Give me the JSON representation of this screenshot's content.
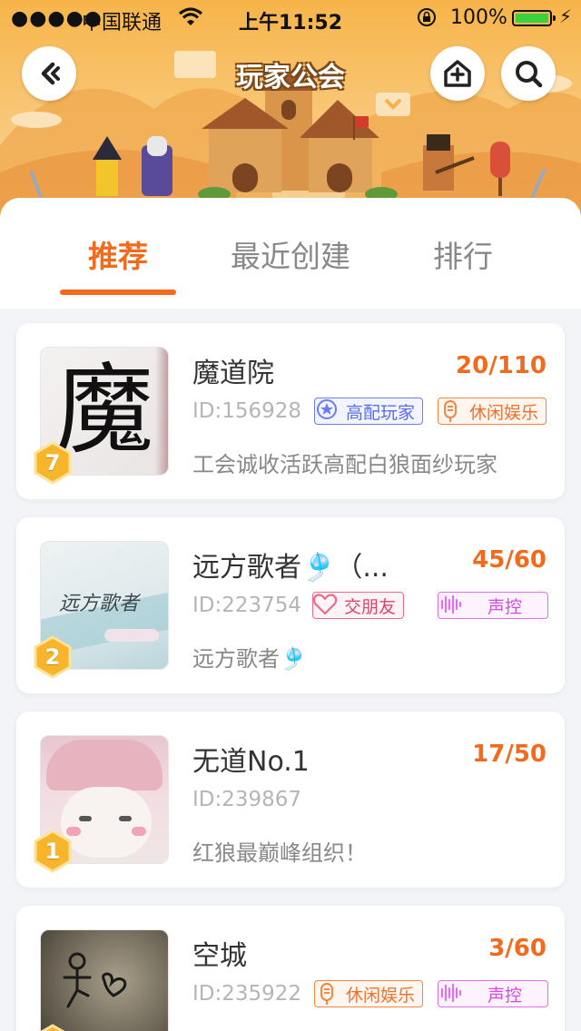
{
  "status_bar": {
    "signal": "●●●●●",
    "carrier": "中国联通",
    "time": "上午11:52",
    "battery_percent": "100%"
  },
  "header": {
    "title": "玩家公会",
    "back_icon": "chevron-left-icon",
    "create_icon": "house-plus-icon",
    "search_icon": "search-icon"
  },
  "tabs": [
    {
      "label": "推荐",
      "active": true
    },
    {
      "label": "最近创建",
      "active": false
    },
    {
      "label": "排行",
      "active": false
    }
  ],
  "guilds": [
    {
      "name": "魔道院",
      "members": "20/110",
      "id": "ID:156928",
      "level": "7",
      "avatar_char": "魔",
      "tags": [
        {
          "label": "高配玩家",
          "style": "blue",
          "icon": "badge-star-icon"
        },
        {
          "label": "休闲娱乐",
          "style": "orange",
          "icon": "microphone-icon"
        }
      ],
      "description": "工会诚收活跃高配白狼面纱玩家"
    },
    {
      "name": "远方歌者🎐（...",
      "members": "45/60",
      "id": "ID:223754",
      "level": "2",
      "avatar_char": "远方歌者",
      "tags": [
        {
          "label": "交朋友",
          "style": "pink",
          "icon": "heart-icon"
        },
        {
          "label": "声控",
          "style": "magenta",
          "icon": "sound-wave-icon"
        }
      ],
      "description": "远方歌者🎐"
    },
    {
      "name": "无道No.1",
      "members": "17/50",
      "id": "ID:239867",
      "level": "1",
      "tags": [],
      "description": "红狼最巅峰组织！"
    },
    {
      "name": "空城",
      "members": "3/60",
      "id": "ID:235922",
      "level": "",
      "tags": [
        {
          "label": "休闲娱乐",
          "style": "orange",
          "icon": "microphone-icon"
        },
        {
          "label": "声控",
          "style": "magenta",
          "icon": "sound-wave-icon"
        }
      ],
      "description": ""
    }
  ],
  "colors": {
    "accent": "#f26b1d",
    "banner": "#f7b44a",
    "level_badge": "#f7b52c"
  }
}
